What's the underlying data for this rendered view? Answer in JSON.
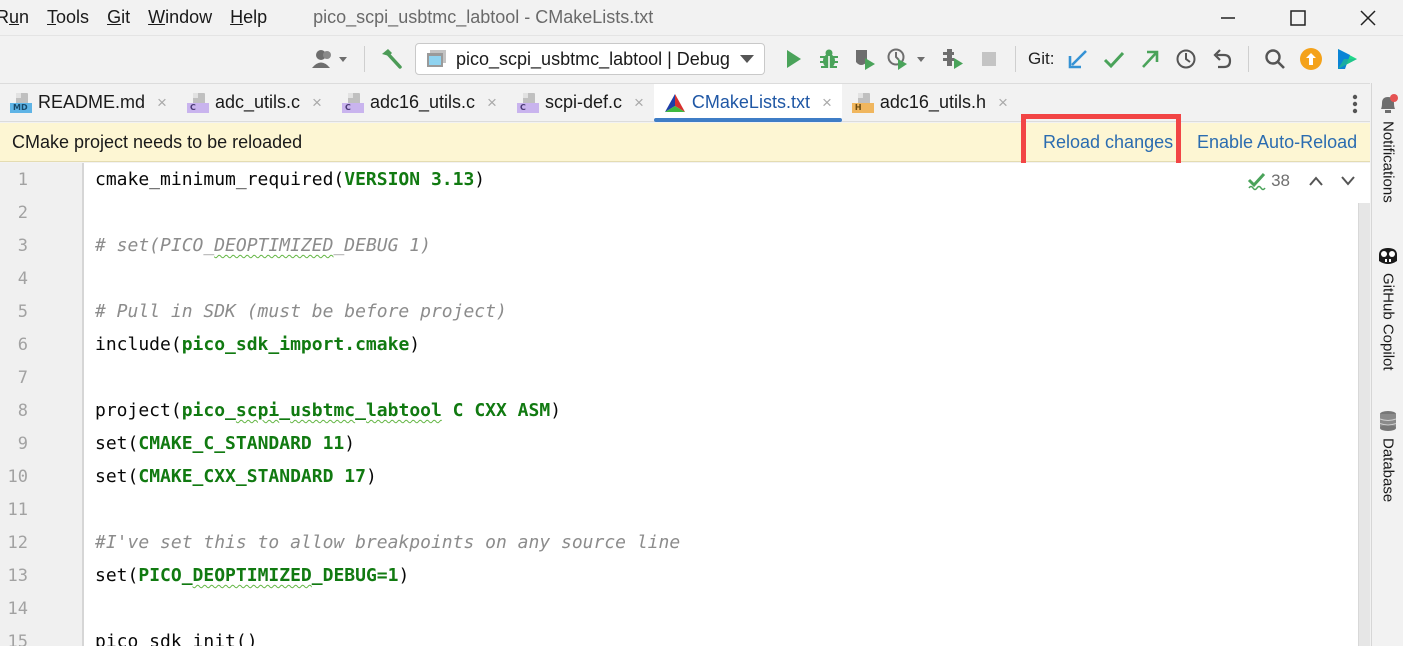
{
  "menubar": {
    "items": [
      "Run",
      "Tools",
      "Git",
      "Window",
      "Help"
    ],
    "mnemonics": [
      "u",
      "T",
      "G",
      "W",
      "H"
    ],
    "window_title": "pico_scpi_usbtmc_labtool - CMakeLists.txt",
    "window_controls": {
      "minimize": "–",
      "maximize": "☐",
      "close": "X"
    }
  },
  "toolbar": {
    "run_config": "pico_scpi_usbtmc_labtool | Debug",
    "git_label": "Git:",
    "icons": [
      "profile-icon",
      "build-hammer-icon",
      "run-icon",
      "debug-icon",
      "coverage-icon",
      "profile-run-icon",
      "attach-icon",
      "stop-icon",
      "git-update-icon",
      "git-commit-icon",
      "git-push-icon",
      "git-history-icon",
      "git-rollback-icon",
      "search-icon",
      "update-icon",
      "toolbox-icon"
    ]
  },
  "tabs": [
    {
      "label": "README.md",
      "type": "md",
      "badge": "MD",
      "active": false
    },
    {
      "label": "adc_utils.c",
      "type": "c",
      "badge": "C",
      "active": false
    },
    {
      "label": "adc16_utils.c",
      "type": "c",
      "badge": "C",
      "active": false
    },
    {
      "label": "scpi-def.c",
      "type": "c",
      "badge": "C",
      "active": false
    },
    {
      "label": "CMakeLists.txt",
      "type": "cmake",
      "badge": "",
      "active": true
    },
    {
      "label": "adc16_utils.h",
      "type": "h",
      "badge": "H",
      "active": false
    }
  ],
  "tab_close_glyph": "×",
  "banner": {
    "message": "CMake project needs to be reloaded",
    "reload_link": "Reload changes",
    "auto_reload_link": "Enable Auto-Reload"
  },
  "editor": {
    "inspection_count": "38",
    "lines": [
      {
        "n": "1",
        "segments": [
          {
            "t": "cmake_minimum_required(",
            "c": ""
          },
          {
            "t": "VERSION 3.13",
            "c": "kw"
          },
          {
            "t": ")",
            "c": ""
          }
        ]
      },
      {
        "n": "2",
        "segments": []
      },
      {
        "n": "3",
        "segments": [
          {
            "t": "# set(PICO_",
            "c": "cm"
          },
          {
            "t": "DEOPTIMIZED",
            "c": "cm squig"
          },
          {
            "t": "_DEBUG 1)",
            "c": "cm"
          }
        ]
      },
      {
        "n": "4",
        "segments": []
      },
      {
        "n": "5",
        "segments": [
          {
            "t": "# Pull in SDK (must be before project)",
            "c": "cm"
          }
        ]
      },
      {
        "n": "6",
        "segments": [
          {
            "t": "include(",
            "c": ""
          },
          {
            "t": "pico_sdk_import.cmake",
            "c": "kw"
          },
          {
            "t": ")",
            "c": ""
          }
        ]
      },
      {
        "n": "7",
        "segments": []
      },
      {
        "n": "8",
        "segments": [
          {
            "t": "project(",
            "c": ""
          },
          {
            "t": "pico_",
            "c": "kw"
          },
          {
            "t": "scpi",
            "c": "kw squig"
          },
          {
            "t": "_",
            "c": "kw"
          },
          {
            "t": "usbtmc",
            "c": "kw squig"
          },
          {
            "t": "_",
            "c": "kw"
          },
          {
            "t": "labtool",
            "c": "kw squig"
          },
          {
            "t": " C CXX ASM",
            "c": "kw"
          },
          {
            "t": ")",
            "c": ""
          }
        ]
      },
      {
        "n": "9",
        "segments": [
          {
            "t": "set(",
            "c": ""
          },
          {
            "t": "CMAKE_C_STANDARD 11",
            "c": "kw"
          },
          {
            "t": ")",
            "c": ""
          }
        ]
      },
      {
        "n": "10",
        "segments": [
          {
            "t": "set(",
            "c": ""
          },
          {
            "t": "CMAKE_CXX_STANDARD 17",
            "c": "kw"
          },
          {
            "t": ")",
            "c": ""
          }
        ]
      },
      {
        "n": "11",
        "segments": []
      },
      {
        "n": "12",
        "segments": [
          {
            "t": "#I've set this to allow breakpoints on any source line",
            "c": "cm"
          }
        ]
      },
      {
        "n": "13",
        "segments": [
          {
            "t": "set(",
            "c": ""
          },
          {
            "t": "PICO_",
            "c": "kw"
          },
          {
            "t": "DEOPTIMIZED",
            "c": "kw squig"
          },
          {
            "t": "_DEBUG=1",
            "c": "kw"
          },
          {
            "t": ")",
            "c": ""
          }
        ]
      },
      {
        "n": "14",
        "segments": []
      },
      {
        "n": "15",
        "segments": [
          {
            "t": "pico_sdk_init()",
            "c": ""
          }
        ]
      }
    ]
  },
  "right_strip": [
    {
      "label": "Notifications",
      "icon": "bell-icon"
    },
    {
      "label": "GitHub Copilot",
      "icon": "copilot-icon"
    },
    {
      "label": "Database",
      "icon": "database-icon"
    }
  ],
  "colors": {
    "accent": "#3f7dc6",
    "link": "#2b6cb0",
    "banner_bg": "#fdf6d3",
    "highlight": "#f24545",
    "keyword": "#117a11",
    "comment": "#8c8c8c"
  }
}
